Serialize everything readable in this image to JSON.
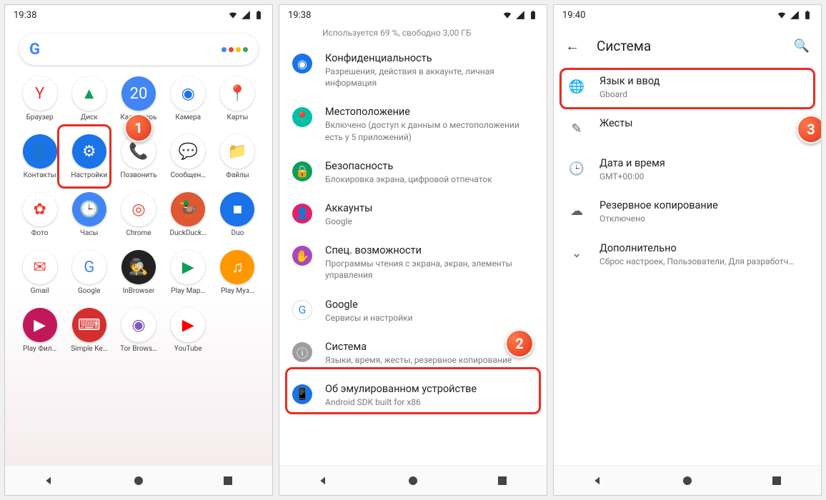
{
  "screen1": {
    "time": "19:38",
    "apps": [
      {
        "label": "Браузер",
        "bg": "#fff",
        "fg": "#d33",
        "letter": "Y"
      },
      {
        "label": "Диск",
        "bg": "#fff",
        "fg": "#0f9d58",
        "letter": "▲"
      },
      {
        "label": "Календарь",
        "bg": "#4285f4",
        "fg": "#fff",
        "letter": "20"
      },
      {
        "label": "Камера",
        "bg": "#fff",
        "fg": "#1a73e8",
        "letter": "◉"
      },
      {
        "label": "Карты",
        "bg": "#fff",
        "fg": "#34a853",
        "letter": "📍"
      },
      {
        "label": "Контакты",
        "bg": "#1a73e8",
        "fg": "#fff",
        "letter": "👤"
      },
      {
        "label": "Настройки",
        "bg": "#1a73e8",
        "fg": "#fff",
        "letter": "⚙"
      },
      {
        "label": "Позвонить",
        "bg": "#fff",
        "fg": "#1a73e8",
        "letter": "📞"
      },
      {
        "label": "Сообщен…",
        "bg": "#fff",
        "fg": "#1a73e8",
        "letter": "💬"
      },
      {
        "label": "Файлы",
        "bg": "#fff",
        "fg": "#1a73e8",
        "letter": "📁"
      },
      {
        "label": "Фото",
        "bg": "#fff",
        "fg": "#ea4335",
        "letter": "✿"
      },
      {
        "label": "Часы",
        "bg": "#4285f4",
        "fg": "#fff",
        "letter": "🕒"
      },
      {
        "label": "Chrome",
        "bg": "#fff",
        "fg": "#ea4335",
        "letter": "◎"
      },
      {
        "label": "DuckDuck…",
        "bg": "#de5833",
        "fg": "#fff",
        "letter": "🦆"
      },
      {
        "label": "Duo",
        "bg": "#1a73e8",
        "fg": "#fff",
        "letter": "■"
      },
      {
        "label": "Gmail",
        "bg": "#fff",
        "fg": "#ea4335",
        "letter": "✉"
      },
      {
        "label": "Google",
        "bg": "#fff",
        "fg": "#4285f4",
        "letter": "G"
      },
      {
        "label": "InBrowser",
        "bg": "#222",
        "fg": "#fff",
        "letter": "🕵"
      },
      {
        "label": "Play Мар…",
        "bg": "#fff",
        "fg": "#0f9d58",
        "letter": "▶"
      },
      {
        "label": "Play Муз…",
        "bg": "#ff9800",
        "fg": "#fff",
        "letter": "♫"
      },
      {
        "label": "Play Фил…",
        "bg": "#c2185b",
        "fg": "#fff",
        "letter": "▶"
      },
      {
        "label": "Simple Ke…",
        "bg": "#d32f2f",
        "fg": "#fff",
        "letter": "⌨"
      },
      {
        "label": "Tor Brows…",
        "bg": "#fff",
        "fg": "#7e57c2",
        "letter": "◉"
      },
      {
        "label": "YouTube",
        "bg": "#fff",
        "fg": "#ff0000",
        "letter": "▶"
      }
    ],
    "badge": "1"
  },
  "screen2": {
    "time": "19:38",
    "truncated": "Используется 69 %, свободно 3,00 ГБ",
    "items": [
      {
        "title": "Конфиденциальность",
        "sub": "Разрешения, действия в аккаунте, личная информация",
        "iconBg": "#1a73e8",
        "iconFg": "#fff",
        "glyph": "◉"
      },
      {
        "title": "Местоположение",
        "sub": "Включено (доступ к данным о местоположении есть у 5 приложений)",
        "iconBg": "#00bfa5",
        "iconFg": "#fff",
        "glyph": "📍"
      },
      {
        "title": "Безопасность",
        "sub": "Блокировка экрана, цифровой отпечаток",
        "iconBg": "#0f9d58",
        "iconFg": "#fff",
        "glyph": "🔒"
      },
      {
        "title": "Аккаунты",
        "sub": "Google",
        "iconBg": "#e91e63",
        "iconFg": "#fff",
        "glyph": "👤"
      },
      {
        "title": "Спец. возможности",
        "sub": "Программы чтения с экрана, экран, элементы управления",
        "iconBg": "#ab47bc",
        "iconFg": "#fff",
        "glyph": "✋"
      },
      {
        "title": "Google",
        "sub": "Сервисы и настройки",
        "iconBg": "#fff",
        "iconFg": "#4285f4",
        "glyph": "G"
      },
      {
        "title": "Система",
        "sub": "Языки, время, жесты, резервное копирование",
        "iconBg": "#9e9e9e",
        "iconFg": "#fff",
        "glyph": "ⓘ"
      },
      {
        "title": "Об эмулированном устройстве",
        "sub": "Android SDK built for x86",
        "iconBg": "#1a73e8",
        "iconFg": "#fff",
        "glyph": "📱"
      }
    ],
    "badge": "2"
  },
  "screen3": {
    "time": "19:40",
    "header": "Система",
    "items": [
      {
        "title": "Язык и ввод",
        "sub": "Gboard",
        "glyph": "🌐"
      },
      {
        "title": "Жесты",
        "sub": "",
        "glyph": "✎"
      },
      {
        "title": "Дата и время",
        "sub": "GMT+00:00",
        "glyph": "🕒"
      },
      {
        "title": "Резервное копирование",
        "sub": "Отключено",
        "glyph": "☁"
      },
      {
        "title": "Дополнительно",
        "sub": "Сброс настроек, Пользователи, Для разработч…",
        "glyph": "⌄"
      }
    ],
    "badge": "3"
  }
}
